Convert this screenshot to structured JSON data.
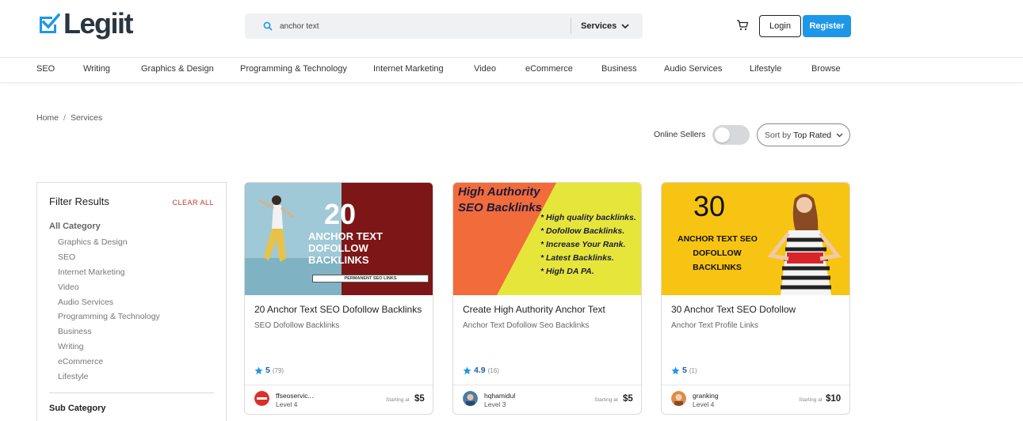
{
  "brand": {
    "name": "Legiit",
    "accent": "#1e97e8",
    "dark": "#2b3541"
  },
  "search": {
    "value": "anchor text",
    "scope": "Services"
  },
  "header": {
    "login_label": "Login",
    "register_label": "Register",
    "cart_icon": "cart-icon"
  },
  "nav": [
    "SEO",
    "Writing",
    "Graphics & Design",
    "Programming & Technology",
    "Internet Marketing",
    "Video",
    "eCommerce",
    "Business",
    "Audio Services",
    "Lifestyle",
    "Browse"
  ],
  "breadcrumb": {
    "home": "Home",
    "separator": "/",
    "current": "Services"
  },
  "toolbar": {
    "online_label": "Online Sellers",
    "sort_prefix": "Sort by",
    "sort_value": "Top Rated"
  },
  "filter": {
    "title": "Filter Results",
    "clear_label": "CLEAR ALL",
    "all_category": "All Category",
    "categories": [
      "Graphics & Design",
      "SEO",
      "Internet Marketing",
      "Video",
      "Audio Services",
      "Programming & Technology",
      "Business",
      "Writing",
      "eCommerce",
      "Lifestyle"
    ],
    "sub_category": "Sub Category"
  },
  "cards": [
    {
      "title": "20 Anchor Text SEO Dofollow Backlinks",
      "subtitle": "SEO Dofollow Backlinks",
      "rating": "5",
      "reviews": "(79)",
      "seller": "ffseoservic...",
      "level": "Level 4",
      "starting_label": "Starting at",
      "price": "$5",
      "image": {
        "big": "20",
        "line1": "ANCHOR TEXT",
        "line2": "DOFOLLOW",
        "line3": "BACKLINKS",
        "banner": "PERMANENT SEO LINKS"
      }
    },
    {
      "title": "Create High Authority Anchor Text",
      "subtitle": "Anchor Text Dofollow Seo Backlinks",
      "rating": "4.9",
      "reviews": "(16)",
      "seller": "hqhamidul",
      "level": "Level 3",
      "starting_label": "Starting at",
      "price": "$5",
      "image": {
        "head1": "High Authority",
        "head2": "SEO Backlinks",
        "bullets": [
          "* High quality backlinks.",
          "* Dofollow Backlinks.",
          "* Increase Your Rank.",
          "* Latest Backlinks.",
          "* High DA PA."
        ]
      }
    },
    {
      "title": "30 Anchor Text SEO Dofollow",
      "subtitle": "Anchor Text Profile Links",
      "rating": "5",
      "reviews": "(1)",
      "seller": "granking",
      "level": "Level 4",
      "starting_label": "Starting at",
      "price": "$10",
      "image": {
        "big": "30",
        "line1": "ANCHOR TEXT SEO",
        "line2": "DOFOLLOW",
        "line3": "BACKLINKS"
      }
    }
  ]
}
